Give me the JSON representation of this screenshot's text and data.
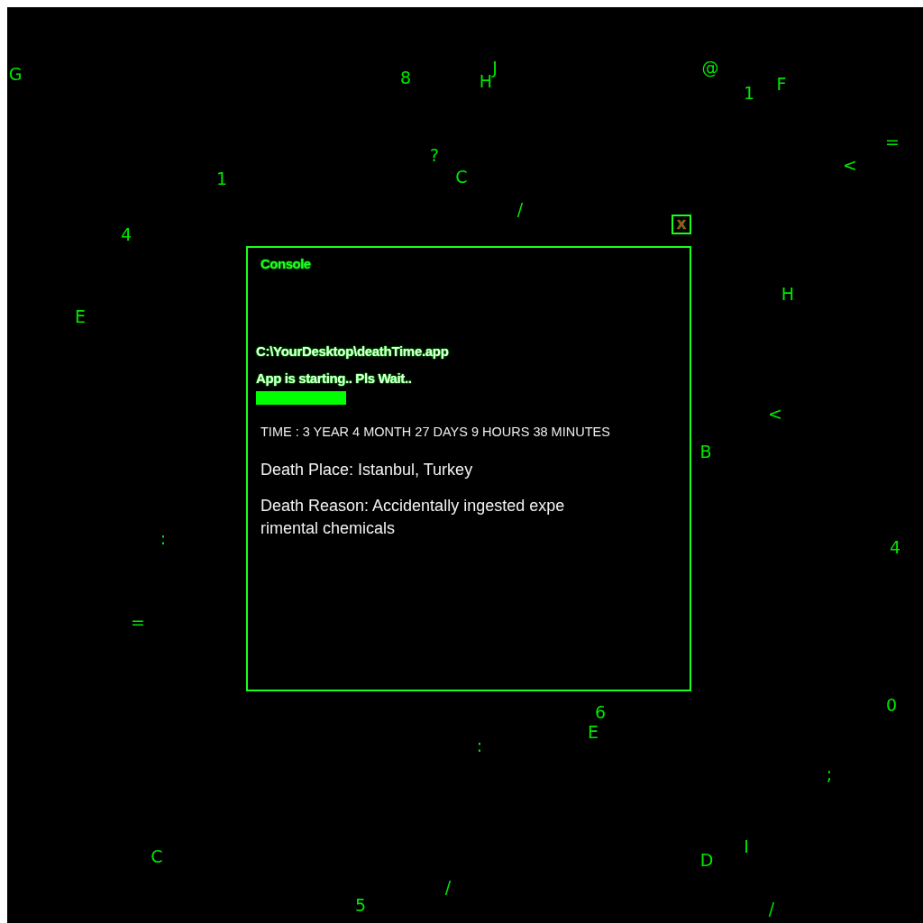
{
  "rain": [
    "G",
    "8",
    "J",
    "H",
    "@",
    "1",
    "F",
    "=",
    "<",
    "?",
    "C",
    "1",
    "/",
    "4",
    "E",
    "H",
    "<",
    "B",
    ":",
    "4",
    "=",
    "6",
    "0",
    "E",
    ":",
    ";",
    "I",
    "C",
    "D",
    "/",
    "5",
    "/"
  ],
  "close_button": {
    "label": "X"
  },
  "console": {
    "title": "Console",
    "path": "C:\\YourDesktop\\deathTime.app",
    "status": "App is starting.. Pls Wait..",
    "time": "TIME : 3 YEAR 4 MONTH 27 DAYS 9 HOURS 38 MINUTES",
    "place": "Death Place: Istanbul, Turkey",
    "reason": "Death Reason: Accidentally ingested expe\nrimental chemicals"
  }
}
